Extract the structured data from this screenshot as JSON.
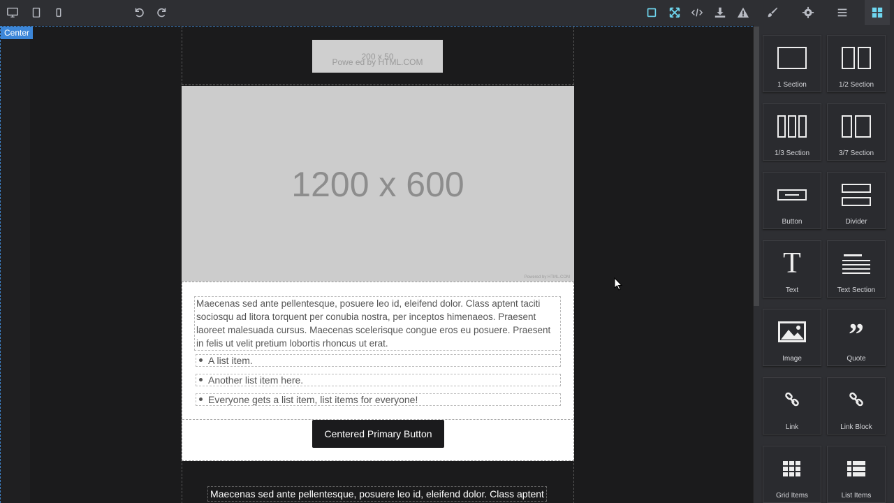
{
  "toolbar": {
    "left": [
      "desktop-icon",
      "tablet-icon",
      "mobile-icon",
      "undo-icon",
      "redo-icon"
    ],
    "right": [
      "sw-visibility-icon",
      "fullscreen-icon",
      "code-icon",
      "download-icon",
      "warning-icon",
      "paint-brush-icon",
      "gear-icon",
      "hamburger-icon",
      "blocks-icon"
    ]
  },
  "canvas": {
    "badge": "Center",
    "logo_placeholder": {
      "size": "200 x 50",
      "powered": "Powe ed by HTML.COM"
    },
    "hero_placeholder": {
      "size": "1200 x 600",
      "powered": "Powered by HTML.COM"
    },
    "paragraph": "Maecenas sed ante pellentesque, posuere leo id, eleifend dolor. Class aptent taciti sociosqu ad litora torquent per conubia nostra, per inceptos himenaeos. Praesent laoreet malesuada cursus. Maecenas scelerisque congue eros eu posuere. Praesent in felis ut velit pretium lobortis rhoncus ut erat.",
    "list_items": [
      "A list item.",
      "Another list item here.",
      "Everyone gets a list item, list items for everyone!"
    ],
    "button_label": "Centered Primary Button",
    "bottom_text": "Maecenas sed ante pellentesque, posuere leo id, eleifend dolor. Class aptent"
  },
  "blocks": [
    {
      "label": "1 Section",
      "icon": "one-section-icon"
    },
    {
      "label": "1/2 Section",
      "icon": "half-section-icon"
    },
    {
      "label": "1/3 Section",
      "icon": "third-section-icon"
    },
    {
      "label": "3/7 Section",
      "icon": "three-seven-section-icon"
    },
    {
      "label": "Button",
      "icon": "button-block-icon"
    },
    {
      "label": "Divider",
      "icon": "divider-icon"
    },
    {
      "label": "Text",
      "icon": "text-icon"
    },
    {
      "label": "Text Section",
      "icon": "text-section-icon"
    },
    {
      "label": "Image",
      "icon": "image-icon"
    },
    {
      "label": "Quote",
      "icon": "quote-icon"
    },
    {
      "label": "Link",
      "icon": "link-icon"
    },
    {
      "label": "Link Block",
      "icon": "link-block-icon"
    },
    {
      "label": "Grid Items",
      "icon": "grid-items-icon"
    },
    {
      "label": "List Items",
      "icon": "list-items-icon"
    }
  ]
}
